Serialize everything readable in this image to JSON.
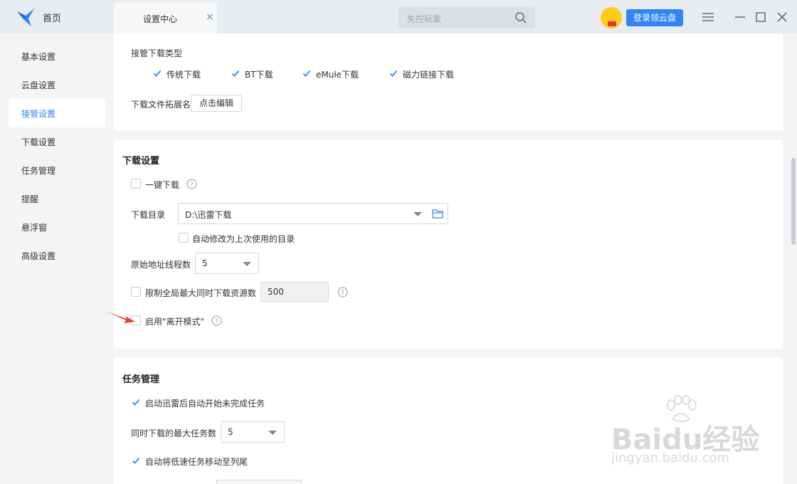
{
  "topbar": {
    "home_label": "首页",
    "tab_label": "设置中心",
    "tab_close": "×",
    "search_placeholder": "失控玩家",
    "login_label": "登录领云盘"
  },
  "sidebar": {
    "items": [
      {
        "label": "基本设置"
      },
      {
        "label": "云盘设置"
      },
      {
        "label": "接管设置"
      },
      {
        "label": "下载设置"
      },
      {
        "label": "任务管理"
      },
      {
        "label": "提醒"
      },
      {
        "label": "悬浮窗"
      },
      {
        "label": "高级设置"
      }
    ],
    "active_index": 2
  },
  "takeover": {
    "types_label": "接管下载类型",
    "options": [
      {
        "label": "传统下载",
        "checked": true
      },
      {
        "label": "BT下载",
        "checked": true
      },
      {
        "label": "eMule下载",
        "checked": true
      },
      {
        "label": "磁力链接下载",
        "checked": true
      }
    ],
    "ext_label": "下载文件拓展名",
    "ext_button": "点击编辑"
  },
  "download": {
    "title": "下载设置",
    "one_click_label": "一键下载",
    "dir_label": "下载目录",
    "dir_value": "D:\\迅雷下载",
    "auto_dir_label": "自动修改为上次使用的目录",
    "threads_label": "原始地址线程数",
    "threads_value": "5",
    "limit_label": "限制全局最大同时下载资源数",
    "limit_value": "500",
    "away_label": "启用\"离开模式\""
  },
  "tasks": {
    "title": "任务管理",
    "auto_start_label": "启动迅雷后自动开始未完成任务",
    "max_tasks_label": "同时下载的最大任务数",
    "max_tasks_value": "5",
    "move_slow_label": "自动将低速任务移动至列尾"
  },
  "watermark": {
    "line1": "Baidu经验",
    "line2": "jingyan.baidu.com"
  },
  "colors": {
    "accent": "#2f86f6",
    "arrow": "#e8403a"
  }
}
